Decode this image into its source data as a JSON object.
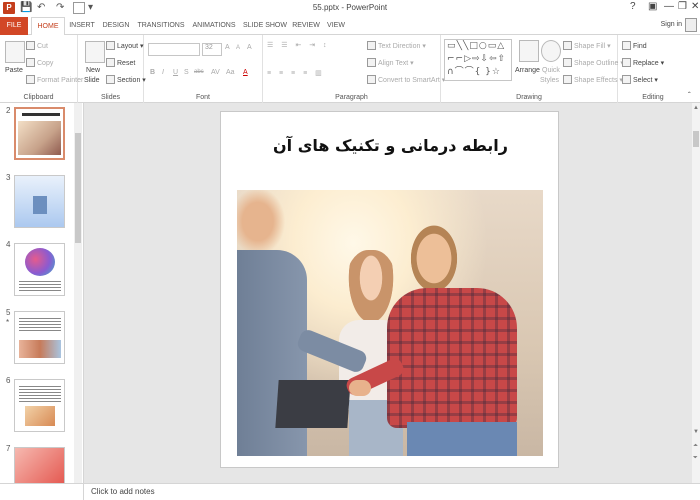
{
  "window": {
    "title": "55.pptx - PowerPoint",
    "help_icon": "?",
    "minimize_icon": "—",
    "restore_icon": "❐",
    "close_icon": "✕"
  },
  "quick_access": {
    "save_icon": "💾",
    "undo_icon": "↶",
    "redo_icon": "↷",
    "customize_icon": "▾"
  },
  "tabs": [
    {
      "label": "FILE"
    },
    {
      "label": "HOME"
    },
    {
      "label": "INSERT"
    },
    {
      "label": "DESIGN"
    },
    {
      "label": "TRANSITIONS"
    },
    {
      "label": "ANIMATIONS"
    },
    {
      "label": "SLIDE SHOW"
    },
    {
      "label": "REVIEW"
    },
    {
      "label": "VIEW"
    }
  ],
  "account": {
    "signin_label": "Sign in"
  },
  "ribbon": {
    "clipboard": {
      "label": "Clipboard",
      "paste": "Paste",
      "cut": "Cut",
      "copy": "Copy",
      "format_painter": "Format Painter"
    },
    "slides": {
      "label": "Slides",
      "new_slide": "New",
      "new_slide2": "Slide",
      "layout": "Layout",
      "reset": "Reset",
      "section": "Section"
    },
    "font": {
      "label": "Font",
      "size": "32",
      "bold": "B",
      "italic": "I",
      "underline": "U",
      "strike": "S",
      "shadow": "abc",
      "spacing": "AV",
      "case": "Aa",
      "grow": "A",
      "shrink": "A",
      "clear": "A"
    },
    "paragraph": {
      "label": "Paragraph",
      "text_direction": "Text Direction",
      "align_text": "Align Text",
      "convert": "Convert to SmartArt"
    },
    "drawing": {
      "label": "Drawing",
      "arrange": "Arrange",
      "quick_styles": "Quick",
      "quick_styles2": "Styles",
      "fill": "Shape Fill",
      "outline": "Shape Outline",
      "effects": "Shape Effects",
      "shapes_row1": "▭╲╲□○▭△",
      "shapes_row2": "⌐⌐▷⇨⇩⇦⇧",
      "shapes_row3": "∩⌒⌒{ }☆"
    },
    "editing": {
      "label": "Editing",
      "find": "Find",
      "replace": "Replace",
      "select": "Select"
    }
  },
  "thumbnails": [
    {
      "number": "2"
    },
    {
      "number": "3"
    },
    {
      "number": "4"
    },
    {
      "number": "5",
      "marker": "*"
    },
    {
      "number": "6"
    },
    {
      "number": "7"
    }
  ],
  "slide": {
    "title": "رابطه درمانی و تکنیک های آن"
  },
  "notes": {
    "placeholder": "Click to add notes"
  }
}
